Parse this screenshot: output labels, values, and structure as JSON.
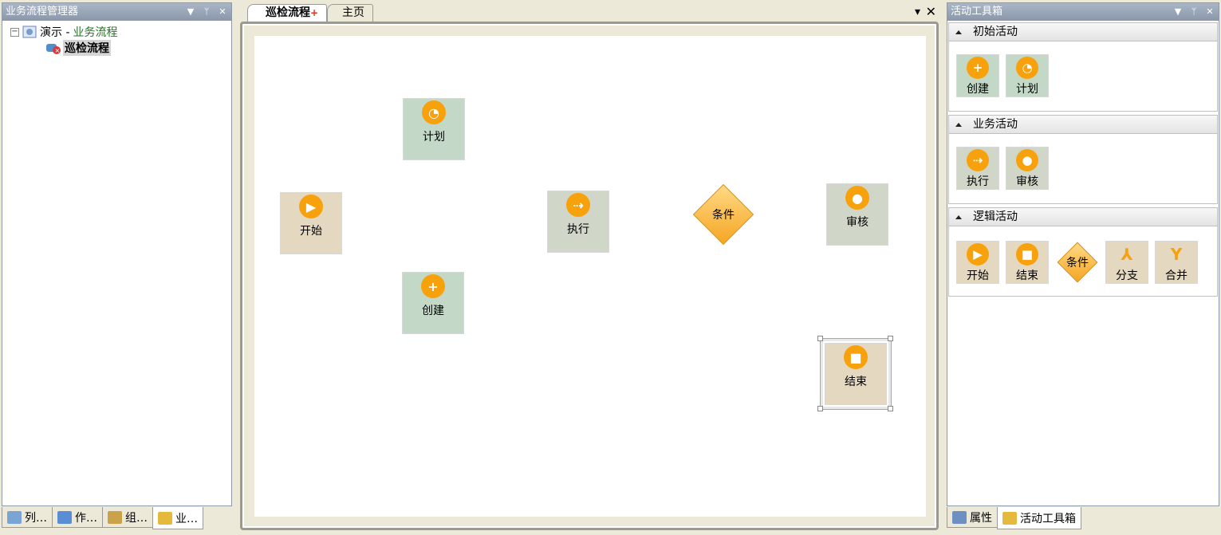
{
  "left_panel": {
    "title": "业务流程管理器",
    "tree": {
      "root_prefix": "演示 - ",
      "root_name": "业务流程",
      "expander": "−",
      "child": "巡检流程"
    },
    "bottom_tabs": [
      "列…",
      "作…",
      "组…",
      "业…"
    ]
  },
  "doc_tabs": {
    "active": "巡检流程",
    "modified_mark": "+",
    "other": "主页"
  },
  "canvas": {
    "nodes": {
      "plan": "计划",
      "start": "开始",
      "execute": "执行",
      "condition": "条件",
      "review": "审核",
      "create": "创建",
      "end": "结束"
    }
  },
  "right_panel": {
    "title": "活动工具箱",
    "groups": [
      {
        "title": "初始活动",
        "items": [
          "创建",
          "计划"
        ]
      },
      {
        "title": "业务活动",
        "items": [
          "执行",
          "审核"
        ]
      },
      {
        "title": "逻辑活动",
        "items": [
          "开始",
          "结束",
          "条件",
          "分支",
          "合并"
        ]
      }
    ],
    "bottom_tabs": [
      "属性",
      "活动工具箱"
    ]
  },
  "colors": {
    "accent_orange": "#f7a20d",
    "node_green": "#c3d8c6",
    "node_beige": "#e4d8c0",
    "titlebar": "#8a97aa"
  },
  "icons": {
    "plan": "clock-icon",
    "create": "plus-icon",
    "start": "play-icon",
    "execute": "arrow-right-icon",
    "review": "user-icon",
    "end": "stop-icon",
    "branch": "branch-icon",
    "merge": "merge-icon"
  }
}
